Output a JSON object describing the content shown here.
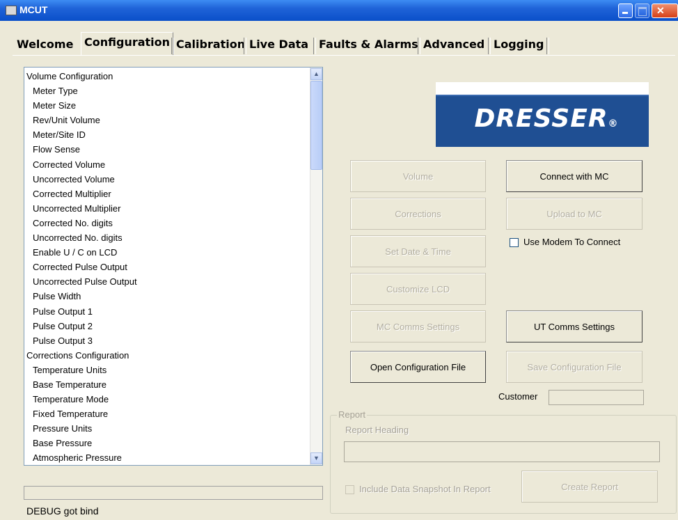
{
  "window": {
    "title": "MCUT"
  },
  "tabs": [
    {
      "label": "Welcome"
    },
    {
      "label": "Configuration"
    },
    {
      "label": "Calibration"
    },
    {
      "label": "Live Data"
    },
    {
      "label": "Faults & Alarms"
    },
    {
      "label": "Advanced"
    },
    {
      "label": "Logging"
    }
  ],
  "list": {
    "items": [
      {
        "label": "Volume Configuration"
      },
      {
        "label": "Meter Type"
      },
      {
        "label": "Meter Size"
      },
      {
        "label": "Rev/Unit Volume"
      },
      {
        "label": "Meter/Site ID"
      },
      {
        "label": "Flow Sense"
      },
      {
        "label": "Corrected Volume"
      },
      {
        "label": "Uncorrected Volume"
      },
      {
        "label": "Corrected Multiplier"
      },
      {
        "label": "Uncorrected Multiplier"
      },
      {
        "label": "Corrected No. digits"
      },
      {
        "label": "Uncorrected No. digits"
      },
      {
        "label": "Enable U / C on LCD"
      },
      {
        "label": "Corrected Pulse Output"
      },
      {
        "label": "Uncorrected Pulse Output"
      },
      {
        "label": "Pulse Width"
      },
      {
        "label": "Pulse Output 1"
      },
      {
        "label": "Pulse Output 2"
      },
      {
        "label": "Pulse Output 3"
      },
      {
        "label": "Corrections Configuration"
      },
      {
        "label": "Temperature Units"
      },
      {
        "label": "Base Temperature"
      },
      {
        "label": "Temperature Mode"
      },
      {
        "label": "Fixed Temperature"
      },
      {
        "label": "Pressure Units"
      },
      {
        "label": "Base Pressure"
      },
      {
        "label": "Atmospheric Pressure"
      }
    ]
  },
  "status": {
    "debug": "DEBUG got bind"
  },
  "logo": {
    "text": "DRESSER",
    "mark": "®"
  },
  "buttons": {
    "volume": "Volume",
    "connect": "Connect with MC",
    "corrections": "Corrections",
    "upload": "Upload to MC",
    "set_date": "Set Date & Time",
    "customize_lcd": "Customize LCD",
    "mc_comms": "MC Comms Settings",
    "ut_comms": "UT Comms Settings",
    "open_config": "Open Configuration File",
    "save_config": "Save Configuration File",
    "create_report": "Create Report"
  },
  "modem": {
    "label": "Use Modem To Connect"
  },
  "customer": {
    "label": "Customer",
    "value": ""
  },
  "report": {
    "legend": "Report",
    "heading_label": "Report Heading",
    "heading_value": "",
    "snapshot_label": "Include Data Snapshot In Report"
  }
}
